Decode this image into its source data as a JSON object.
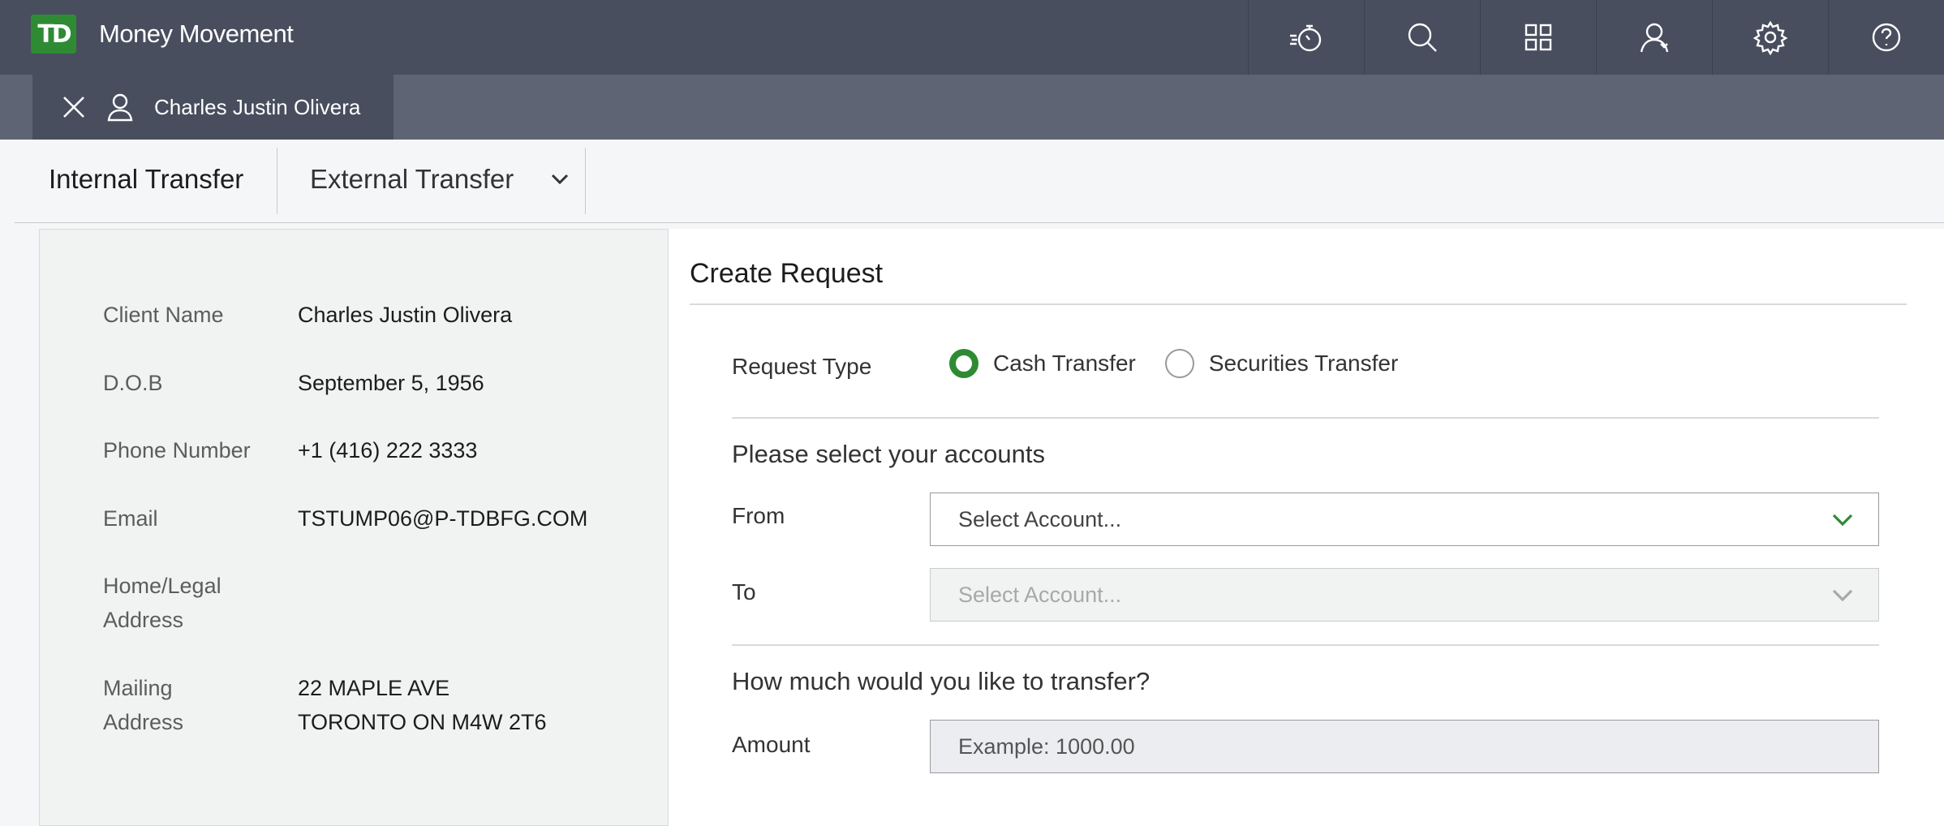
{
  "app": {
    "logo_text": "TD",
    "title": "Money Movement"
  },
  "topbar_icons": [
    "stopwatch-icon",
    "search-icon",
    "grid-icon",
    "user-switch-icon",
    "gear-icon",
    "help-icon"
  ],
  "client_tab": {
    "name": "Charles Justin Olivera"
  },
  "transfer_tabs": {
    "internal": "Internal Transfer",
    "external": "External Transfer"
  },
  "client_info": {
    "client_name_label": "Client Name",
    "client_name": "Charles Justin Olivera",
    "dob_label": "D.O.B",
    "dob": "September 5, 1956",
    "phone_label": "Phone Number",
    "phone": "+1 (416) 222 3333",
    "email_label": "Email",
    "email": "TSTUMP06@P-TDBFG.COM",
    "home_label_1": "Home/Legal",
    "home_label_2": "Address",
    "home": "",
    "mailing_label_1": "Mailing",
    "mailing_label_2": "Address",
    "mailing_line_1": "22 MAPLE AVE",
    "mailing_line_2": "TORONTO ON M4W 2T6"
  },
  "request": {
    "title": "Create Request",
    "request_type_label": "Request Type",
    "options": [
      {
        "label": "Cash Transfer",
        "checked": true
      },
      {
        "label": "Securities Transfer",
        "checked": false
      }
    ],
    "accounts_title": "Please select your accounts",
    "from_label": "From",
    "from_value": "Select Account...",
    "to_label": "To",
    "to_value": "Select Account...",
    "amount_title": "How much would you like to transfer?",
    "amount_label": "Amount",
    "amount_placeholder": "Example: 1000.00"
  },
  "colors": {
    "brand_green": "#2e8b34",
    "topbar": "#484e5e",
    "tabbar": "#5e6474"
  }
}
